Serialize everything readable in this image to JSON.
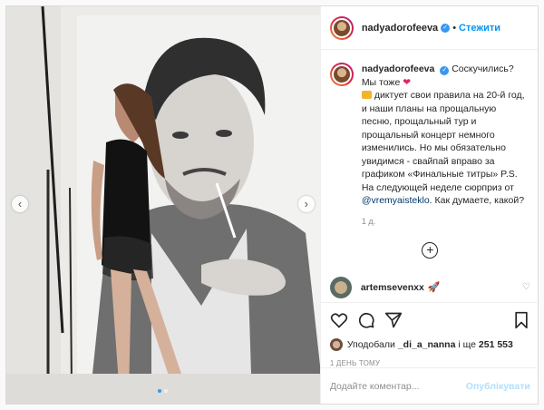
{
  "post": {
    "username": "nadyadorofeeva",
    "follow_label": "Стежити",
    "separator": "•"
  },
  "caption": {
    "username": "nadyadorofeeva",
    "line1": "Соскучились? Мы тоже",
    "text_a": "диктует свои правила на 20-й год, и наши планы на прощальную песню, прощальный тур и прощальный концерт немного изменились. Но мы обязательно увидимся - свайпай вправо за графиком «Финальные титры» P.S. На следующей неделе сюрприз от",
    "mention": "@vremyaisteklo",
    "text_b": ". Как думаете, какой?",
    "time": "1 д."
  },
  "comment": {
    "username": "artemsevenxx"
  },
  "likes": {
    "prefix": "Уподобали",
    "user": "_di_a_nanna",
    "middle": "і ще",
    "count": "251 553"
  },
  "post_time": "1 ДЕНЬ ТОМУ",
  "add_comment": {
    "placeholder": "Додайте коментар...",
    "publish_label": "Опублікувати"
  },
  "colors": {
    "accent": "#0095f6",
    "verified": "#3897f0",
    "heart": "#e0245e"
  },
  "icons": [
    "heart-icon",
    "comment-icon",
    "share-icon",
    "bookmark-icon",
    "add-circle-icon",
    "verified-icon",
    "chevron-left-icon",
    "chevron-right-icon"
  ]
}
